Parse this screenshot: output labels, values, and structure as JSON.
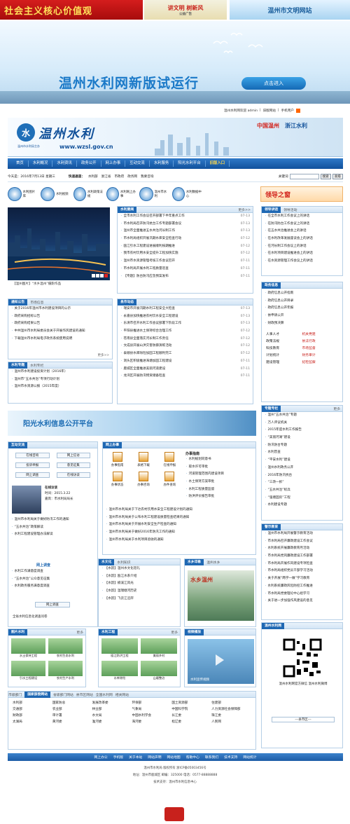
{
  "banner": {
    "core_values": "社会主义核心价值观",
    "mid": "讲文明 树新风",
    "mid_sub": "公益广告",
    "right": "温州市文明网站"
  },
  "hero": {
    "title": "温州水利网新版试运行",
    "button": "点击进入"
  },
  "top_links": [
    "温州水利网欢迎 admin",
    "旧版网站",
    "手机用户"
  ],
  "logo": {
    "name": "温州水利",
    "sub": "温州市水利局主办",
    "url": "www.wzsl.gov.cn",
    "slogan_a": "中国温州",
    "slogan_b": "浙江水利"
  },
  "nav": [
    "首页",
    "水利概况",
    "水利资讯",
    "政务公开",
    "网上办事",
    "互动交流",
    "水利服务",
    "阳光水利平台",
    "旧版入口"
  ],
  "datebar": {
    "date": "今天是：2016年7月13日 星期三",
    "quick": "快速通道：",
    "links": [
      "水利部",
      "浙江省",
      "市政府",
      "政务网",
      "我要咨询"
    ],
    "search_label": "关键词",
    "search_btn": "搜索",
    "adv_btn": "高级"
  },
  "icons": [
    {
      "label": "水利图片库"
    },
    {
      "label": "水利视频"
    },
    {
      "label": "水利政策法规"
    },
    {
      "label": "水利网上办事"
    },
    {
      "label": "温州市水利"
    },
    {
      "label": "水利数据中心"
    }
  ],
  "wenhua": "领导之窗",
  "photo_caption": "【温州图片】“水乡温州”摄影作品",
  "news": {
    "tab": "水利要闻",
    "more": "更多>>",
    "items": [
      {
        "t": "全市水利工作会议召开部署下半年重点工作",
        "d": "07-13"
      },
      {
        "t": "市水利局召开防汛抗台工作专题部署会议",
        "d": "07-13"
      },
      {
        "t": "温州市全面推进五水共治河长制工作",
        "d": "07-13"
      },
      {
        "t": "市水利局组织开展汛期水库安全检查行动",
        "d": "07-12"
      },
      {
        "t": "瓯江引水工程建设进展顺利按期推进",
        "d": "07-12"
      },
      {
        "t": "我市农村饮用水安全提升工程加快实施",
        "d": "07-12"
      },
      {
        "t": "温州市水资源管理考核工作会议召开",
        "d": "07-11"
      },
      {
        "t": "市水利局开展水利工程质量巡查",
        "d": "07-11"
      },
      {
        "t": "【专题】防台防汛应急预案发布",
        "d": "07-11"
      }
    ]
  },
  "leader": {
    "tab": "领导讲话",
    "tab2": "领导活动",
    "more": "更多",
    "items": [
      "在全市水利工作会议上的讲话",
      "在防汛防台工作会议上的讲话",
      "在五水共治推进会上的讲话",
      "在水利改革发展座谈会上的讲话",
      "在河长制工作会议上的讲话",
      "在水利项目建设推进会上的讲话",
      "在水资源管理工作会议上的讲话"
    ]
  },
  "notice": {
    "tab": "通知公告",
    "tab2": "市场信息",
    "more": "更多>>",
    "items": [
      "关于2016年温州市水利建设项目的公示",
      "政府采购招标公告",
      "政府采购结果公告",
      "中共温州市水利局委员会关于开展作风建设的通知",
      "下载温州市水利局电子政务系统使用说明"
    ]
  },
  "county": {
    "tab": "县市动态",
    "items": [
      {
        "t": "瑞安市开展汛期水利工程安全大检查",
        "d": "07-13"
      },
      {
        "t": "永嘉县加快推进农村饮水安全工程建设",
        "d": "07-13"
      },
      {
        "t": "乐清市召开水利工作会议部署下阶段工作",
        "d": "07-13"
      },
      {
        "t": "平阳县推进水土保持综合治理工作",
        "d": "07-12"
      },
      {
        "t": "苍南县全面落实河长制工作责任",
        "d": "07-12"
      },
      {
        "t": "文成县开展山洪灾害防御演练活动",
        "d": "07-12"
      },
      {
        "t": "泰顺县水库除险加固工程顺利完工",
        "d": "07-12"
      },
      {
        "t": "洞头区积极推进海塘加固工程建设",
        "d": "07-11"
      },
      {
        "t": "鹿城区全面推进美丽河道建设",
        "d": "07-11"
      },
      {
        "t": "龙湾区开展防汛物资储备检查",
        "d": "07-11"
      }
    ]
  },
  "special": {
    "tab": "水利专题",
    "tab2": "水利专栏",
    "items": [
      "温州市水利建设投资计划（2016年）",
      "温州市“五水共治”专项行动计划",
      "温州市水资源公报（2015年度）"
    ]
  },
  "public": {
    "tab": "政务信息",
    "more": "更多",
    "items": [
      "政府信息公开指南",
      "政府信息公开目录",
      "政府信息公开年报",
      "依申请公开",
      "财政预决算"
    ],
    "grid": [
      "人事人才",
      "机关党建",
      "政策法规",
      "依法行政",
      "科技教育",
      "市场监督",
      "计划统计",
      "财务审计",
      "建设管理",
      "纪检监察"
    ]
  },
  "topics": {
    "tab": "专题专栏",
    "more": "更多",
    "items": [
      "温州“五水共治”专题",
      "万人评议机关",
      "2015年度水利工作报告",
      "“美丽河湖”建设",
      "防汛防台专题",
      "水利普查",
      "“平安水利”建设",
      "温州水利政务公开",
      "2016年防汛抗台",
      "“三改一拆”",
      "“五水共治”标兵",
      "“强塘固房”工程",
      "水利建设专题"
    ]
  },
  "platform": "阳光水利信息公开平台",
  "interact": {
    "tab": "互动交流",
    "chips": [
      "在线咨询",
      "网上信访",
      "投诉举报",
      "意见征集",
      "网上调查",
      "在线访谈"
    ],
    "interview": {
      "title": "在线访谈",
      "date": "时间：2015.3.22",
      "guest": "嘉宾：市水利局局长",
      "desc": "温州市水利局在线访谈栏目"
    },
    "items": [
      "温州市水利局关于做好防汛工作的通知",
      "“五水共治”政策解读",
      "水利工程建设管理办法解读"
    ],
    "more": "更多>>",
    "survey_title": "网上调查",
    "survey_items": [
      "水利工作满意度调查",
      "“五水共治”公众意见征集",
      "水利政务服务满意度调查"
    ],
    "survey_btn": "网上调查",
    "survey_foot": "全省水利信息化调查问卷"
  },
  "service": {
    "tab": "网上办事",
    "guide": "办事指南",
    "steps": [
      "办事指南",
      "表格下载",
      "在线申报",
      "办事状态",
      "办事咨询",
      "办件查询"
    ],
    "guide_items": [
      "水利规划同意书",
      "取水许可审批",
      "河道管理范围内建设项目",
      "水土保持方案审批",
      "水利工程质量监督",
      "防洪评价报告审批"
    ],
    "items": [
      "温州市水利局关于下达农村饮用水安全工程建设计划的通知",
      "温州市水利局关于公布水利工程建设质量检查结果的通知",
      "温州市水利局关于开展水利安全生产检查的通知",
      "温州市水利局关于做好2016年防汛工作的通知",
      "温州市水利局关于水利项目验收的通知"
    ],
    "more": "更多>>"
  },
  "culture": {
    "tab": "水文化",
    "tab2": "水利知识",
    "items": [
      "【水韵】温州水文化巡礼",
      "【水韵】瓯江水系介绍",
      "【水韵】楠溪江风光",
      "【水韵】温瑞塘河历史",
      "【水韵】飞云江沿岸"
    ]
  },
  "hometown": {
    "tab": "水乡印象",
    "tab2": "温州水乡",
    "caption": "水乡温州"
  },
  "gallery": {
    "t1": "图片水利",
    "t2": "水利工程",
    "t3": "视频播放",
    "more": "更多",
    "c1": [
      "水土保持工程",
      "农村生态水利",
      "引水工程建设",
      "农村生产水利"
    ],
    "c2": [
      "瓯江防洪工程",
      "美丽乡村",
      "水库除险",
      "山塘整治"
    ],
    "c3": [
      "水利宣传视频"
    ]
  },
  "knowledge": {
    "tab": "警示教育",
    "more": "更多",
    "items": [
      "温州市水利局开展警示教育活动",
      "市水利局召开廉政建设工作会议",
      "水利系统开展廉政教育月活动",
      "市水利局党风廉政建设工作部署",
      "市水利局开展作风建设专项检查",
      "市水利局组织党员干部学习活动",
      "关于开展“两学一做”学习教育",
      "水利系统廉政风险防控工作推进",
      "市水利局党委理论中心组学习",
      "关于进一步加强作风建设的意见"
    ]
  },
  "wechat": {
    "tab": "温州水利网",
    "caption": "温州水利网官方微信 温州水利微博"
  },
  "links": {
    "tabs": [
      "市级部门",
      "国家部委网站",
      "省级部门网站",
      "县市区网站",
      "全国水利网",
      "相关网站"
    ],
    "items": [
      "水利部",
      "国家防总",
      "发展改革委",
      "环保部",
      "国土资源部",
      "住建部",
      "交通部",
      "农业部",
      "林业部",
      "气象局",
      "中国科学院",
      "人力资源社会保障部",
      "财政部",
      "审计署",
      "水文局",
      "中国水利学会",
      "长江委",
      "珠江委",
      "太湖局",
      "黄河委",
      "淮河委",
      "海河委",
      "松辽委",
      "人民网"
    ],
    "county_select": "---县市区---"
  },
  "footer_links": [
    "网上办公",
    "手机版",
    "关于本站",
    "网站声明",
    "网站地图",
    "帮助中心",
    "联系我们",
    "技术支持",
    "网站统计"
  ],
  "footer": [
    "温州市水利局 版权所有 浙ICP备05003456号",
    "地址：温州市鹿城区 邮编：325000 电话：0577-88888888",
    "技术支持：温州市水利信息中心"
  ]
}
